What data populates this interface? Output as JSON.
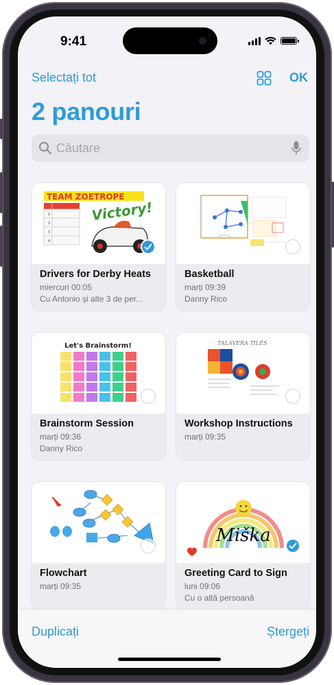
{
  "status": {
    "time": "9:41"
  },
  "nav": {
    "select_all": "Selectați tot",
    "done": "OK"
  },
  "title": "2 panouri",
  "search": {
    "placeholder": "Căutare"
  },
  "boards": [
    {
      "title": "Drivers for Derby Heats",
      "date": "miercuri 00:05",
      "shared": "Cu Antonio și alte 3 de per...",
      "selected": true,
      "thumb": {
        "banner": "TEAM ZOETROPE",
        "headline": "Victory!",
        "rows": [
          "1",
          "2",
          "3",
          "4"
        ]
      }
    },
    {
      "title": "Basketball",
      "date": "marți 09:39",
      "shared": "Danny Rico",
      "selected": false
    },
    {
      "title": "Brainstorm Session",
      "date": "marți 09:36",
      "shared": "Danny Rico",
      "selected": false,
      "thumb": {
        "heading": "Let's Brainstorm!"
      }
    },
    {
      "title": "Workshop Instructions",
      "date": "marți 09:35",
      "shared": "",
      "selected": false,
      "thumb": {
        "heading": "TALAVERA TILES"
      }
    },
    {
      "title": "Flowchart",
      "date": "marți 09:35",
      "shared": "",
      "selected": false
    },
    {
      "title": "Greeting Card to Sign",
      "date": "luni 09:06",
      "shared": "Cu o altă persoană",
      "selected": true,
      "thumb": {
        "script": "Miška"
      }
    }
  ],
  "bottom": {
    "duplicate": "Duplicați",
    "delete": "Ștergeți"
  },
  "colors": {
    "accent": "#2f9bd6",
    "background": "#f2f2f7"
  }
}
